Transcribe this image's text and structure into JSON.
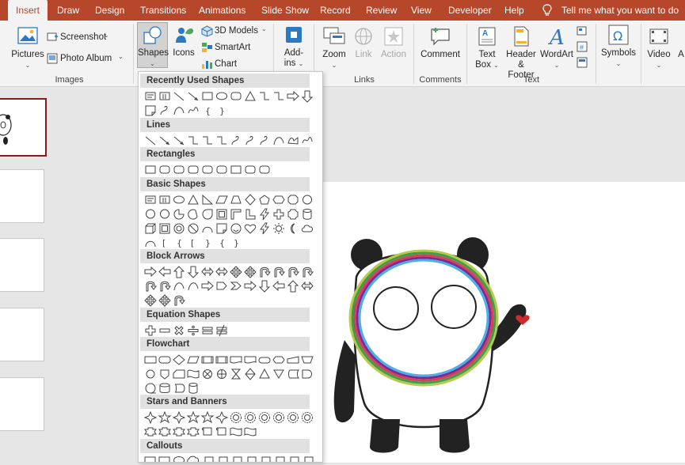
{
  "tabs": [
    {
      "label": "Insert",
      "active": true
    },
    {
      "label": "Draw"
    },
    {
      "label": "Design"
    },
    {
      "label": "Transitions"
    },
    {
      "label": "Animations"
    },
    {
      "label": "Slide Show"
    },
    {
      "label": "Record"
    },
    {
      "label": "Review"
    },
    {
      "label": "View"
    },
    {
      "label": "Developer"
    },
    {
      "label": "Help"
    }
  ],
  "tell_me": "Tell me what you want to do",
  "ribbon": {
    "images": {
      "pictures": "Pictures",
      "screenshot": "Screenshot",
      "photo_album": "Photo Album",
      "group": "Images"
    },
    "illustrations": {
      "shapes": "Shapes",
      "icons": "Icons",
      "models": "3D Models",
      "smartart": "SmartArt",
      "chart": "Chart"
    },
    "addins": {
      "line1": "Add-",
      "line2": "ins"
    },
    "links": {
      "zoom": "Zoom",
      "link": "Link",
      "action": "Action",
      "group": "Links"
    },
    "comments": {
      "comment": "Comment",
      "group": "Comments"
    },
    "text": {
      "textbox1": "Text",
      "textbox2": "Box",
      "header1": "Header",
      "header2": "& Footer",
      "wordart": "WordArt",
      "group": "Text"
    },
    "symbols": {
      "symbols": "Symbols"
    },
    "media": {
      "video": "Video",
      "audio": "A"
    }
  },
  "shapes_menu": {
    "sections": [
      {
        "title": "Recently Used Shapes"
      },
      {
        "title": "Lines"
      },
      {
        "title": "Rectangles"
      },
      {
        "title": "Basic Shapes"
      },
      {
        "title": "Block Arrows"
      },
      {
        "title": "Equation Shapes"
      },
      {
        "title": "Flowchart"
      },
      {
        "title": "Stars and Banners"
      },
      {
        "title": "Callouts"
      }
    ]
  },
  "colors": {
    "accent": "#b7472a",
    "selected_thumb": "#8b1a1a",
    "rainbow": [
      "#4aaee8",
      "#7b2a90",
      "#d8405a",
      "#3b9f48",
      "#b9c94a"
    ],
    "heart": "#d02a2a"
  }
}
